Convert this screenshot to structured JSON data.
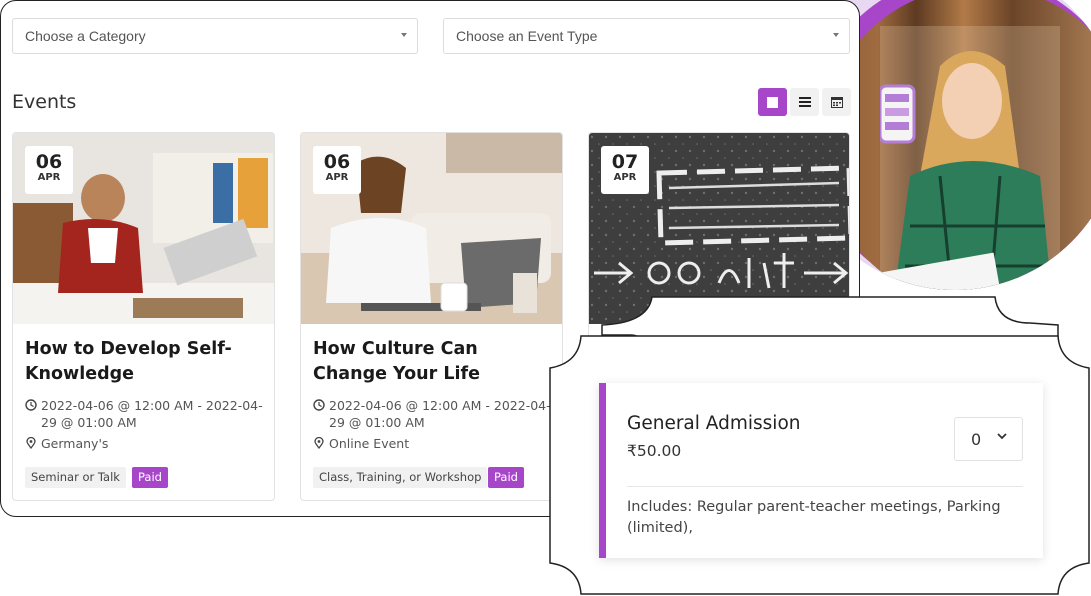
{
  "filters": {
    "category_placeholder": "Choose a Category",
    "event_type_placeholder": "Choose an Event Type"
  },
  "events_heading": "Events",
  "view_modes": [
    {
      "name": "grid",
      "icon": "grid-square-icon",
      "active": true
    },
    {
      "name": "list",
      "icon": "list-lines-icon",
      "active": false
    },
    {
      "name": "calendar",
      "icon": "calendar-icon",
      "active": false
    }
  ],
  "events": [
    {
      "day": "06",
      "month": "APR",
      "title": "How to Develop Self-Knowledge",
      "datetime": "2022-04-06 @ 12:00 AM - 2022-04-29 @ 01:00 AM",
      "location": "Germany's",
      "category": "Seminar or Talk",
      "price_tag": "Paid"
    },
    {
      "day": "06",
      "month": "APR",
      "title": "How Culture Can Change Your Life",
      "datetime": "2022-04-06 @ 12:00 AM - 2022-04-29 @ 01:00 AM",
      "location": "Online Event",
      "category": "Class, Training, or Workshop",
      "price_tag": "Paid"
    },
    {
      "day": "07",
      "month": "APR"
    }
  ],
  "ticket": {
    "name": "General Admission",
    "price": "₹50.00",
    "quantity": "0",
    "includes": "Includes: Regular parent-teacher meetings, Parking (limited),"
  },
  "colors": {
    "accent": "#a746c9",
    "tag_bg": "#f1f1f1",
    "border": "#222222"
  }
}
